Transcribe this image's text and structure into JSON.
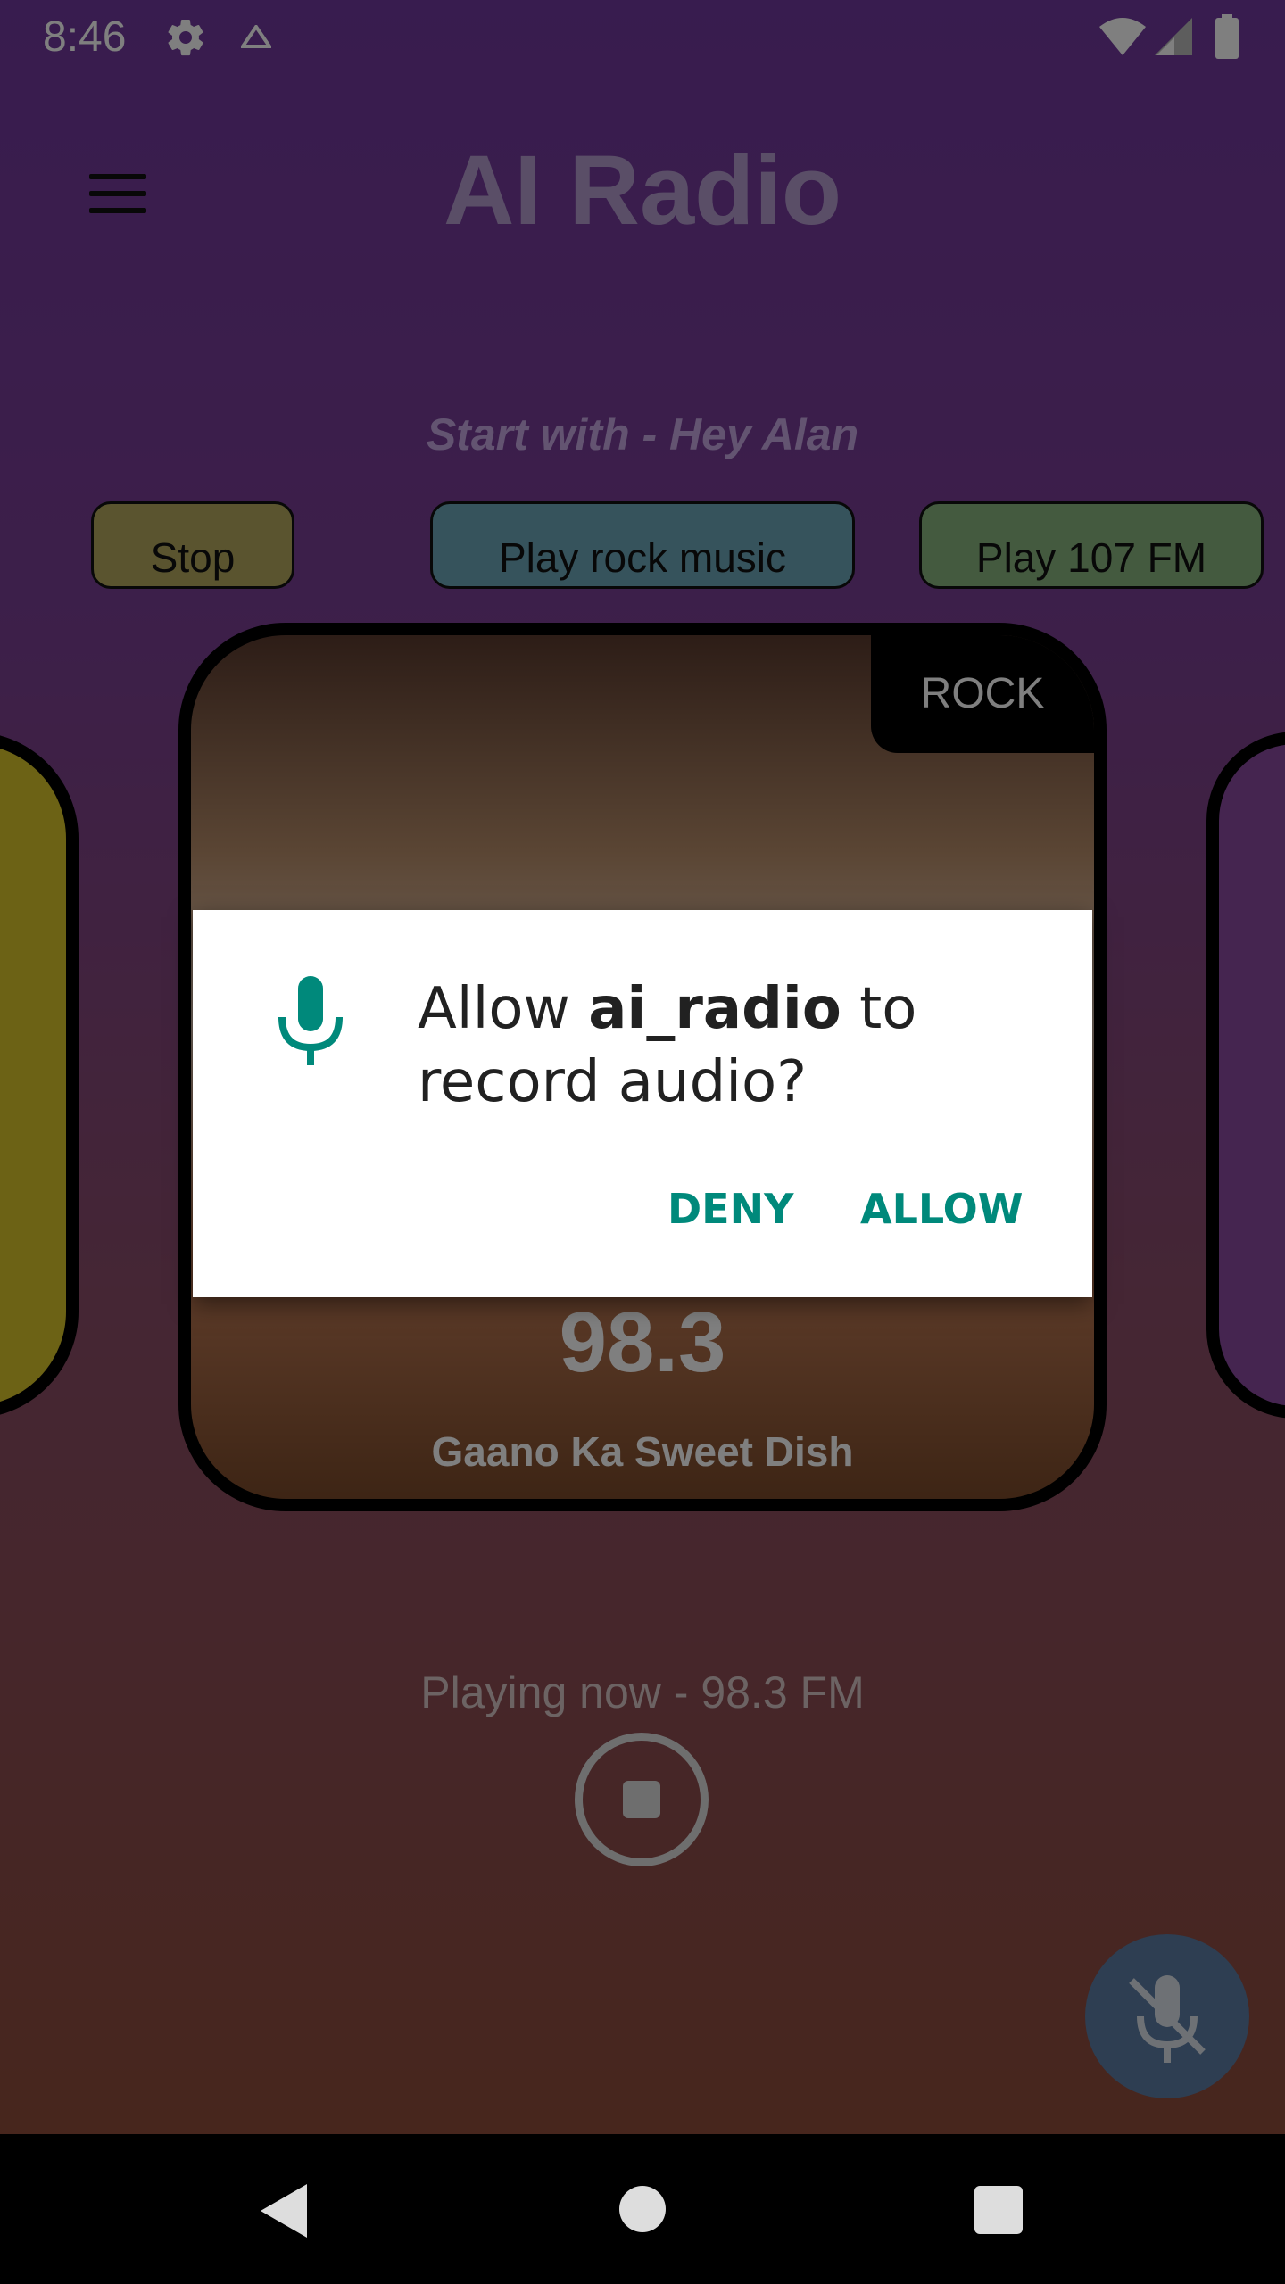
{
  "status_bar": {
    "time": "8:46"
  },
  "app": {
    "title": "AI Radio",
    "subtitle": "Start with - Hey Alan",
    "chips": {
      "stop": "Stop",
      "rock": "Play rock music",
      "fm": "Play 107 FM"
    }
  },
  "card": {
    "genre": "ROCK",
    "frequency": "98.3",
    "station": "Gaano Ka Sweet Dish"
  },
  "player": {
    "status": "Playing now - 98.3 FM"
  },
  "dialog": {
    "prefix": "Allow ",
    "app_name": "ai_radio",
    "suffix": " to record audio?",
    "deny": "DENY",
    "allow": "ALLOW"
  },
  "colors": {
    "accent": "#00897b"
  }
}
